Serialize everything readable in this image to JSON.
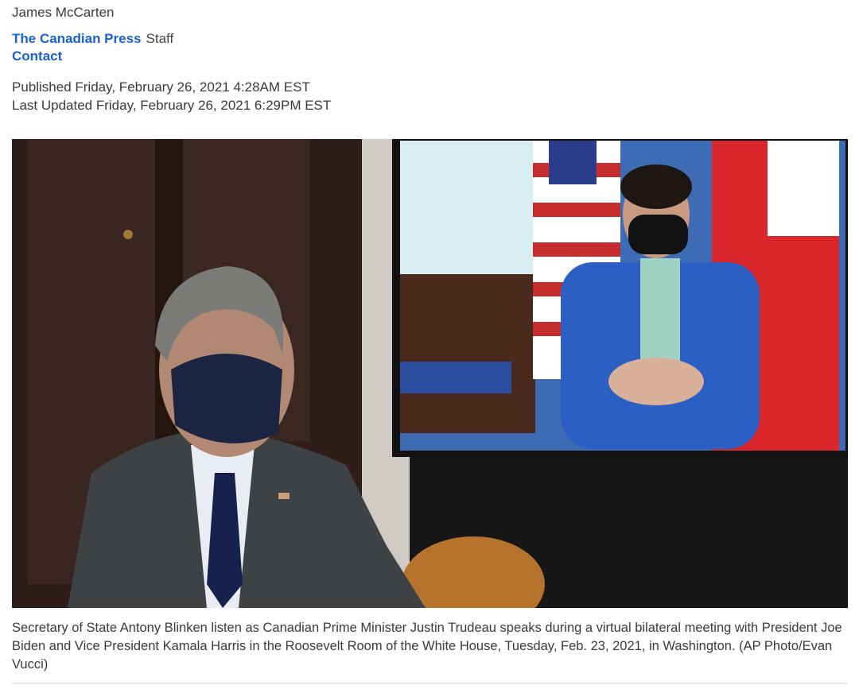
{
  "byline": {
    "author": "James McCarten",
    "source": "The Canadian Press",
    "role": "Staff",
    "contact": "Contact"
  },
  "dates": {
    "published": "Published Friday, February 26, 2021 4:28AM EST",
    "updated": "Last Updated Friday, February 26, 2021 6:29PM EST"
  },
  "photo": {
    "caption": "Secretary of State Antony Blinken listen as Canadian Prime Minister Justin Trudeau speaks during a virtual bilateral meeting with President Joe Biden and Vice President Kamala Harris in the Roosevelt Room of the White House, Tuesday, Feb. 23, 2021, in Washington. (AP Photo/Evan Vucci)"
  },
  "colors": {
    "link": "#1a5fd6",
    "text": "#3a3a3a"
  }
}
